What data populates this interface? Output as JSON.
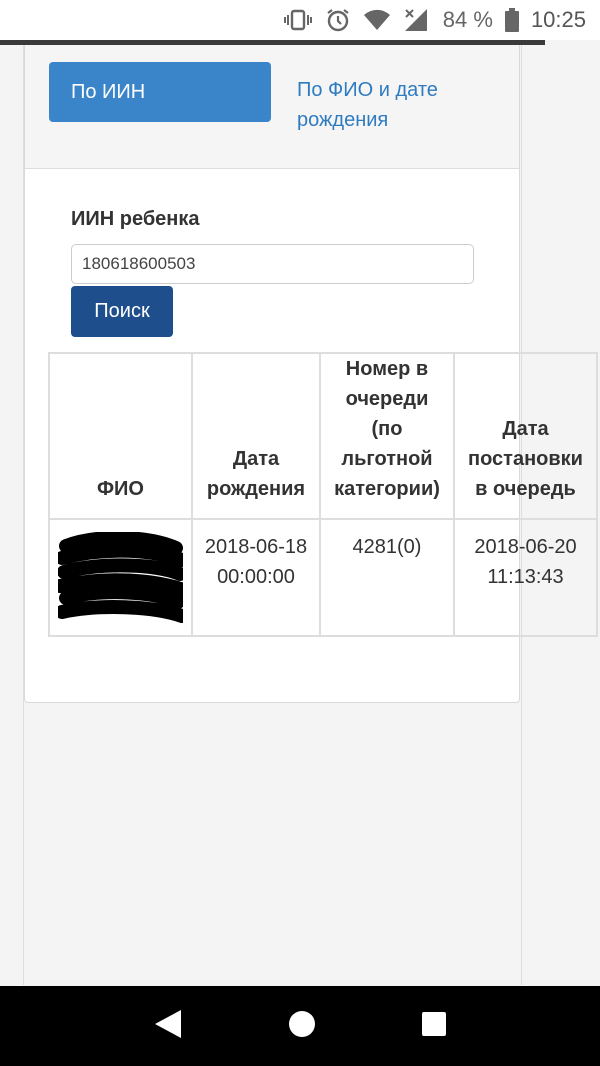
{
  "status_bar": {
    "battery_percent": "84 %",
    "time": "10:25",
    "icons": [
      "vibrate-icon",
      "alarm-icon",
      "wifi-icon",
      "signal-icon",
      "battery-icon"
    ]
  },
  "search": {
    "tab_iin_label": "По ИИН",
    "tab_fio_label": "По ФИО и дате рождения",
    "iin_label": "ИИН ребенка",
    "iin_value": "180618600503",
    "search_button_label": "Поиск"
  },
  "table": {
    "headers": [
      "ФИО",
      "Дата рождения",
      "Номер в очереди (по льготной категории)",
      "Дата постановки в очередь"
    ],
    "rows": [
      {
        "birth_date": "2018-06-18 00:00:00",
        "queue_number": "4281(0)",
        "registration_date": "2018-06-20 11:13:43"
      }
    ]
  },
  "colors": {
    "active_tab": "#3a84c9",
    "link": "#2f7bbf",
    "button": "#1e4f8c"
  }
}
